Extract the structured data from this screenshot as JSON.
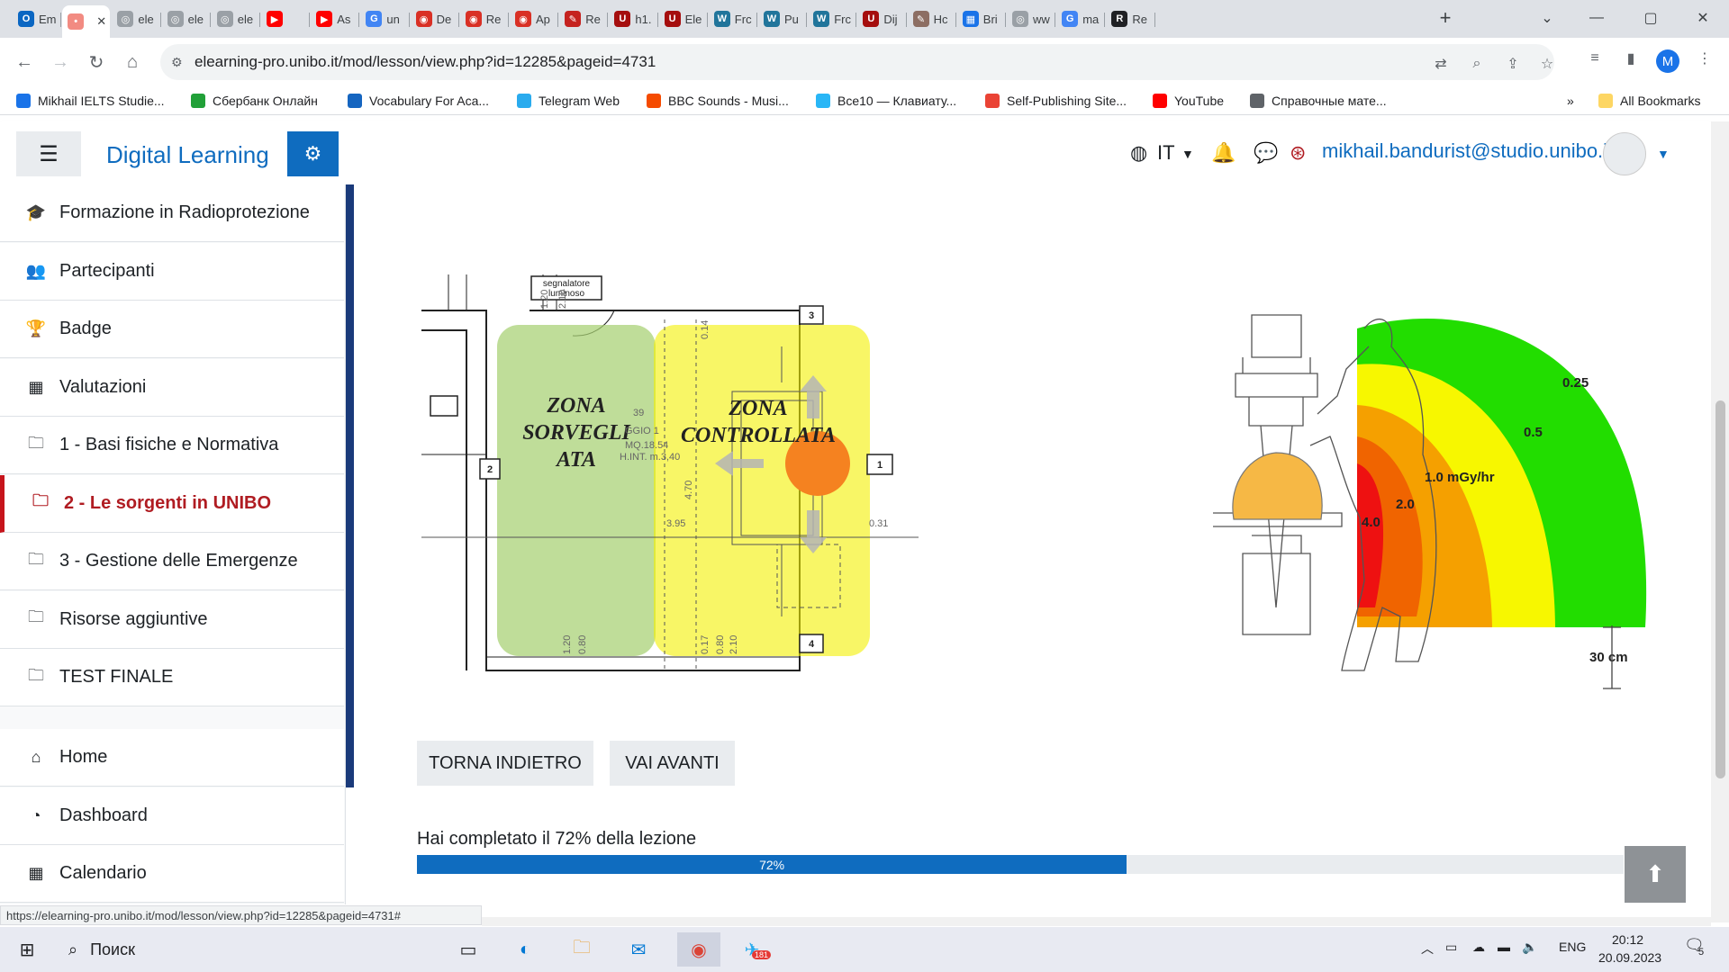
{
  "browser": {
    "tabs": [
      {
        "label": "Em",
        "color": "#0a66c2",
        "glyph": "O"
      },
      {
        "label": "",
        "color": "#f28b82",
        "glyph": "•",
        "active": true
      },
      {
        "label": "ele",
        "color": "#9aa0a6",
        "glyph": "◎"
      },
      {
        "label": "ele",
        "color": "#9aa0a6",
        "glyph": "◎"
      },
      {
        "label": "ele",
        "color": "#9aa0a6",
        "glyph": "◎"
      },
      {
        "label": "",
        "color": "#ff0000",
        "glyph": "▶"
      },
      {
        "label": "As",
        "color": "#ff0000",
        "glyph": "▶"
      },
      {
        "label": "un",
        "color": "#4285f4",
        "glyph": "G"
      },
      {
        "label": "De",
        "color": "#d93025",
        "glyph": "◉"
      },
      {
        "label": "Re",
        "color": "#d93025",
        "glyph": "◉"
      },
      {
        "label": "Ap",
        "color": "#d93025",
        "glyph": "◉"
      },
      {
        "label": "Re",
        "color": "#c5221f",
        "glyph": "✎"
      },
      {
        "label": "h1.",
        "color": "#a50e0e",
        "glyph": "U"
      },
      {
        "label": "Ele",
        "color": "#a50e0e",
        "glyph": "U"
      },
      {
        "label": "Frc",
        "color": "#21759b",
        "glyph": "W"
      },
      {
        "label": "Pu",
        "color": "#21759b",
        "glyph": "W"
      },
      {
        "label": "Frc",
        "color": "#21759b",
        "glyph": "W"
      },
      {
        "label": "Dij",
        "color": "#a50e0e",
        "glyph": "U"
      },
      {
        "label": "Hc",
        "color": "#8d6e63",
        "glyph": "✎"
      },
      {
        "label": "Bri",
        "color": "#1a73e8",
        "glyph": "▦"
      },
      {
        "label": "ww",
        "color": "#9aa0a6",
        "glyph": "◎"
      },
      {
        "label": "ma",
        "color": "#4285f4",
        "glyph": "G"
      },
      {
        "label": "Re",
        "color": "#202124",
        "glyph": "R"
      }
    ],
    "url": "elearning-pro.unibo.it/mod/lesson/view.php?id=12285&pageid=4731",
    "profile_initial": "M",
    "bookmarks": [
      {
        "label": "Mikhail IELTS Studie...",
        "color": "#1a73e8"
      },
      {
        "label": "Сбербанк Онлайн",
        "color": "#21a038"
      },
      {
        "label": "Vocabulary For Aca...",
        "color": "#1565c0"
      },
      {
        "label": "Telegram Web",
        "color": "#2aabee"
      },
      {
        "label": "BBC Sounds - Musi...",
        "color": "#f54b00"
      },
      {
        "label": "Все10 — Клавиату...",
        "color": "#29b6f6"
      },
      {
        "label": "Self-Publishing Site...",
        "color": "#ea4335"
      },
      {
        "label": "YouTube",
        "color": "#ff0000"
      },
      {
        "label": "Справочные мате...",
        "color": "#5f6368"
      }
    ],
    "bookmarks_more": "»",
    "all_bookmarks": "All Bookmarks"
  },
  "moodle": {
    "site_name": "Digital Learning",
    "language": "IT",
    "user_email": "mikhail.bandurist@studio.unibo.it"
  },
  "sidebar": {
    "items": [
      {
        "label": "Formazione in Radioprotezione",
        "icon": "graduation-cap-icon",
        "glyph": "🎓"
      },
      {
        "label": "Partecipanti",
        "icon": "users-icon",
        "glyph": "👥"
      },
      {
        "label": "Badge",
        "icon": "trophy-icon",
        "glyph": "🏆"
      },
      {
        "label": "Valutazioni",
        "icon": "table-icon",
        "glyph": "▦"
      },
      {
        "label": "1 - Basi fisiche e Normativa",
        "icon": "folder-icon",
        "glyph": "🗀"
      },
      {
        "label": "2 - Le sorgenti in UNIBO",
        "icon": "folder-icon",
        "glyph": "🗀",
        "active": true
      },
      {
        "label": "3 - Gestione delle Emergenze",
        "icon": "folder-icon",
        "glyph": "🗀"
      },
      {
        "label": "Risorse aggiuntive",
        "icon": "folder-icon",
        "glyph": "🗀"
      },
      {
        "label": "TEST FINALE",
        "icon": "folder-icon",
        "glyph": "🗀"
      }
    ],
    "bottom_items": [
      {
        "label": "Home",
        "icon": "home-icon",
        "glyph": "⌂"
      },
      {
        "label": "Dashboard",
        "icon": "dashboard-icon",
        "glyph": "◔"
      },
      {
        "label": "Calendario",
        "icon": "calendar-icon",
        "glyph": "▦"
      }
    ]
  },
  "floorplan": {
    "zone_supervised": [
      "ZONA",
      "SORVEGLI",
      "ATA"
    ],
    "zone_controlled": [
      "ZONA",
      "CONTROLLATA"
    ],
    "sign_label": [
      "segnalatore",
      "luminoso"
    ],
    "markers": [
      "1",
      "2",
      "3",
      "4"
    ],
    "dims": [
      "1.20",
      "2.10",
      "0.14",
      "4.70",
      "3.95",
      "0.31",
      "1.20",
      "0.80",
      "0.17",
      "0.80",
      "2.10"
    ],
    "room_text": [
      "39",
      "GGIO 1",
      "MQ.18.54",
      "H.INT. m.3,40"
    ]
  },
  "dose_figure": {
    "labels": [
      "0.25",
      "0.5",
      "1.0 mGy/hr",
      "2.0",
      "4.0"
    ],
    "scale_label": "30 cm",
    "colors": {
      "green": "#22dd00",
      "yellow": "#f7f700",
      "orange": "#f5a000",
      "darkorange": "#f06400",
      "red": "#ee1111",
      "patient": "#f6b845"
    }
  },
  "lesson": {
    "back_button": "TORNA INDIETRO",
    "next_button": "VAI AVANTI",
    "progress_text": "Hai completato il 72% della lezione",
    "progress_value": 72,
    "progress_label": "72%"
  },
  "status_url": "https://elearning-pro.unibo.it/mod/lesson/view.php?id=12285&pageid=4731#",
  "taskbar": {
    "search_placeholder": "Поиск",
    "telegram_badge": "181",
    "language": "ENG",
    "time": "20:12",
    "date": "20.09.2023",
    "notifications": "5"
  }
}
